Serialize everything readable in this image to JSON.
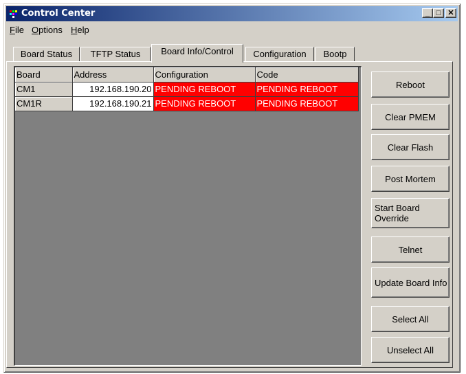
{
  "window": {
    "title": "Control Center"
  },
  "titlebar_buttons": {
    "minimize": "_",
    "maximize": "□",
    "close": "✕"
  },
  "menu": [
    {
      "label": "File",
      "mnemonic": "F"
    },
    {
      "label": "Options",
      "mnemonic": "O"
    },
    {
      "label": "Help",
      "mnemonic": "H"
    }
  ],
  "tabs": [
    {
      "label": "Board Status",
      "active": false
    },
    {
      "label": "TFTP Status",
      "active": false
    },
    {
      "label": "Board Info/Control",
      "active": true
    },
    {
      "label": "Configuration",
      "active": false
    },
    {
      "label": "Bootp",
      "active": false
    }
  ],
  "table": {
    "headers": [
      "Board",
      "Address",
      "Configuration",
      "Code"
    ],
    "rows": [
      [
        "CM1",
        "192.168.190.20",
        "PENDING REBOOT",
        "PENDING REBOOT"
      ],
      [
        "CM1R",
        "192.168.190.21",
        "PENDING REBOOT",
        "PENDING REBOOT"
      ]
    ],
    "status_color": "#ff0000"
  },
  "buttons": {
    "reboot": "Reboot",
    "clear_pmem": "Clear PMEM",
    "clear_flash": "Clear Flash",
    "post_mortem": "Post Mortem",
    "start_board_override": "Start Board Override",
    "telnet": "Telnet",
    "update_board_info": "Update Board Info",
    "select_all": "Select All",
    "unselect_all": "Unselect All"
  },
  "colors": {
    "titlebar_start": "#0a246a",
    "titlebar_end": "#a6caf0",
    "face": "#d4d0c8",
    "grid_bg": "#808080"
  }
}
